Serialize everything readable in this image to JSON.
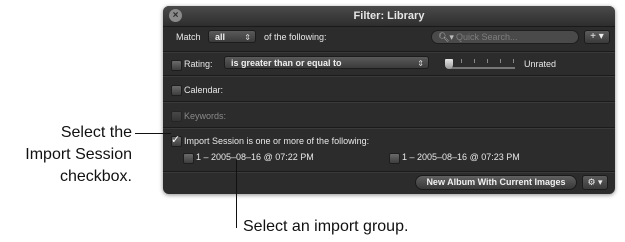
{
  "window": {
    "title": "Filter: Library"
  },
  "match": {
    "label": "Match",
    "value": "all",
    "suffix": "of the following:"
  },
  "search": {
    "placeholder": "Quick Search..."
  },
  "add_button": {
    "label": "+ ▾"
  },
  "rating": {
    "label": "Rating:",
    "operator": "is greater than or equal to",
    "value_label": "Unrated"
  },
  "calendar": {
    "label": "Calendar:"
  },
  "keywords": {
    "label": "Keywords:"
  },
  "import_session": {
    "label": "Import Session is one or more of the following:",
    "checked": true,
    "groups": [
      "1 – 2005–08–16 @ 07:22 PM",
      "1 – 2005–08–16 @ 07:23 PM"
    ]
  },
  "footer": {
    "new_album_label": "New Album With Current Images",
    "gear_label": "⚙ ▾"
  },
  "callouts": {
    "left": [
      "Select the",
      "Import Session",
      "checkbox."
    ],
    "bottom": "Select an import group."
  }
}
